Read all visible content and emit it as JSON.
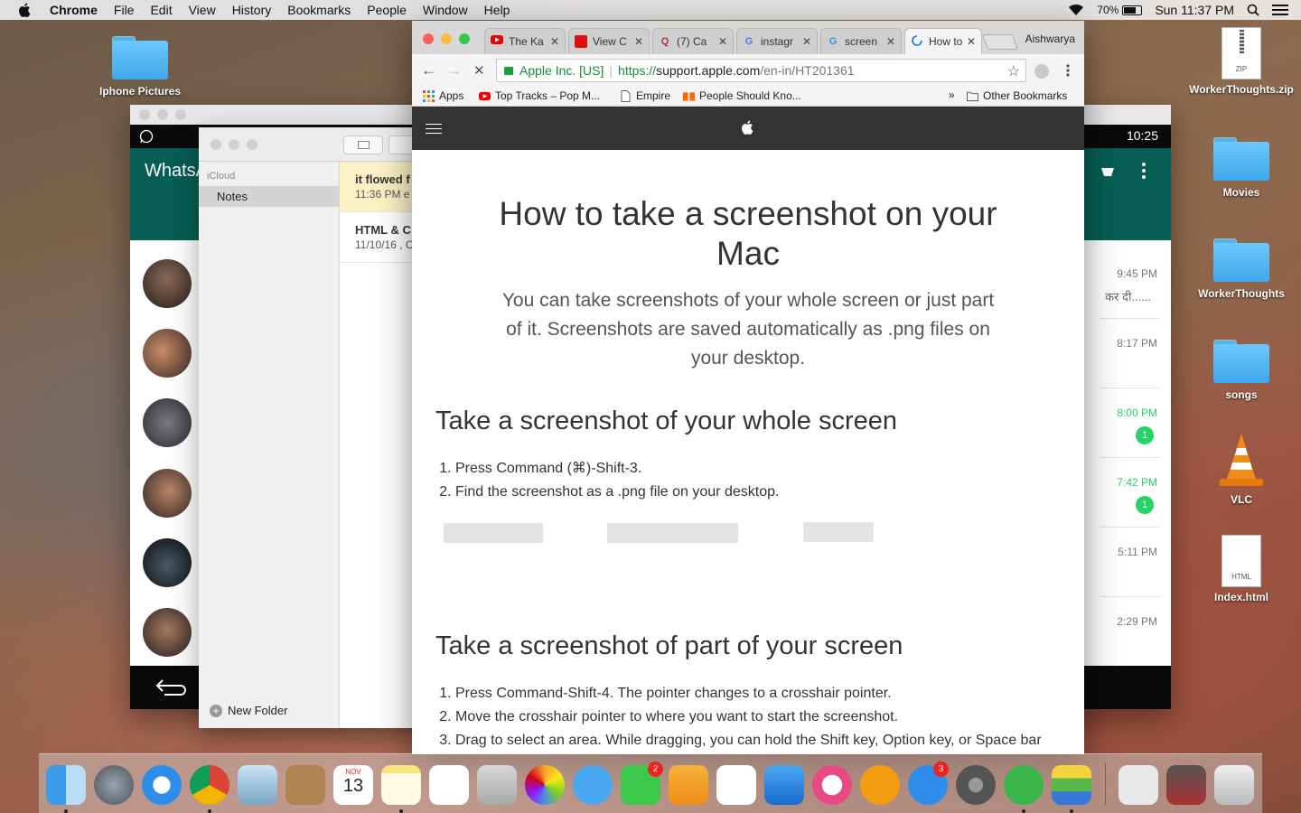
{
  "menubar": {
    "app": "Chrome",
    "items": [
      "File",
      "Edit",
      "View",
      "History",
      "Bookmarks",
      "People",
      "Window",
      "Help"
    ],
    "battery": "70%",
    "clock": "Sun 11:37 PM"
  },
  "desktop": {
    "left_icon": "Iphone Pictures",
    "right_icons": [
      "WorkerThoughts.zip",
      "Movies",
      "WorkerThoughts",
      "songs",
      "VLC",
      "Index.html"
    ],
    "zip_tag": "ZIP",
    "html_tag": "HTML"
  },
  "whatsapp": {
    "title": "WhatsA",
    "status_time": "10:25",
    "chats": [
      {
        "time": "9:45 PM",
        "preview": "कर दी......",
        "unread": ""
      },
      {
        "time": "8:17 PM",
        "preview": "",
        "unread": ""
      },
      {
        "time": "8:00 PM",
        "preview": "",
        "unread": "1"
      },
      {
        "time": "7:42 PM",
        "preview": "",
        "unread": "1"
      },
      {
        "time": "5:11 PM",
        "preview": "",
        "unread": ""
      },
      {
        "time": "2:29 PM",
        "preview": "",
        "unread": ""
      }
    ]
  },
  "notes": {
    "section": "iCloud",
    "folder": "Notes",
    "new_folder": "New Folder",
    "items": [
      {
        "title": "it flowed f",
        "date": "11:36 PM  e"
      },
      {
        "title": "HTML & C",
        "date": "11/10/16  , C"
      }
    ]
  },
  "chrome": {
    "profile": "Aishwarya",
    "tabs": [
      {
        "label": "The Ka",
        "icon": "youtube-icon"
      },
      {
        "label": "View C",
        "icon": "view-icon"
      },
      {
        "label": "(7) Ca",
        "icon": "quora-icon"
      },
      {
        "label": "instagr",
        "icon": "google-icon"
      },
      {
        "label": "screen",
        "icon": "google-icon"
      },
      {
        "label": "How to",
        "icon": "loading-icon"
      }
    ],
    "url": {
      "org": "Apple Inc. [US]",
      "scheme": "https://",
      "host": "support.apple.com",
      "path": "/en-in/HT201361"
    },
    "bookmarks": [
      "Apps",
      "Top Tracks – Pop M...",
      "Empire",
      "People Should Kno..."
    ],
    "bookmarks_more": "»",
    "other_bookmarks": "Other Bookmarks"
  },
  "article": {
    "title": "How to take a screenshot on your Mac",
    "intro": "You can take screenshots of your whole screen or just part of it. Screenshots are saved automatically as .png files on your desktop.",
    "section1": {
      "heading": "Take a screenshot of your whole screen",
      "steps": [
        "Press Command (⌘)-Shift-3.",
        "Find the screenshot as a .png file on your desktop."
      ]
    },
    "section2": {
      "heading": "Take a screenshot of part of your screen",
      "steps": [
        "Press Command-Shift-4. The pointer changes to a crosshair pointer.",
        "Move the crosshair pointer to where you want to start the screenshot.",
        "Drag to select an area. While dragging, you can hold the Shift key, Option key, or Space bar"
      ]
    }
  },
  "dock": {
    "apps": [
      "Finder",
      "Launchpad",
      "Safari",
      "Chrome",
      "Preview",
      "Contacts",
      "Calendar",
      "Notes",
      "Reminders",
      "Photo Booth",
      "Photos",
      "Messages",
      "FaceTime",
      "Pages",
      "Numbers",
      "Keynote",
      "iTunes",
      "iBooks",
      "App Store",
      "System Preferences",
      "uTorrent",
      "BlueStacks",
      "Downloads",
      "Screenshots",
      "Trash"
    ],
    "calendar_month": "NOV",
    "calendar_day": "13",
    "facetime_badge": "2",
    "appstore_badge": "3"
  }
}
